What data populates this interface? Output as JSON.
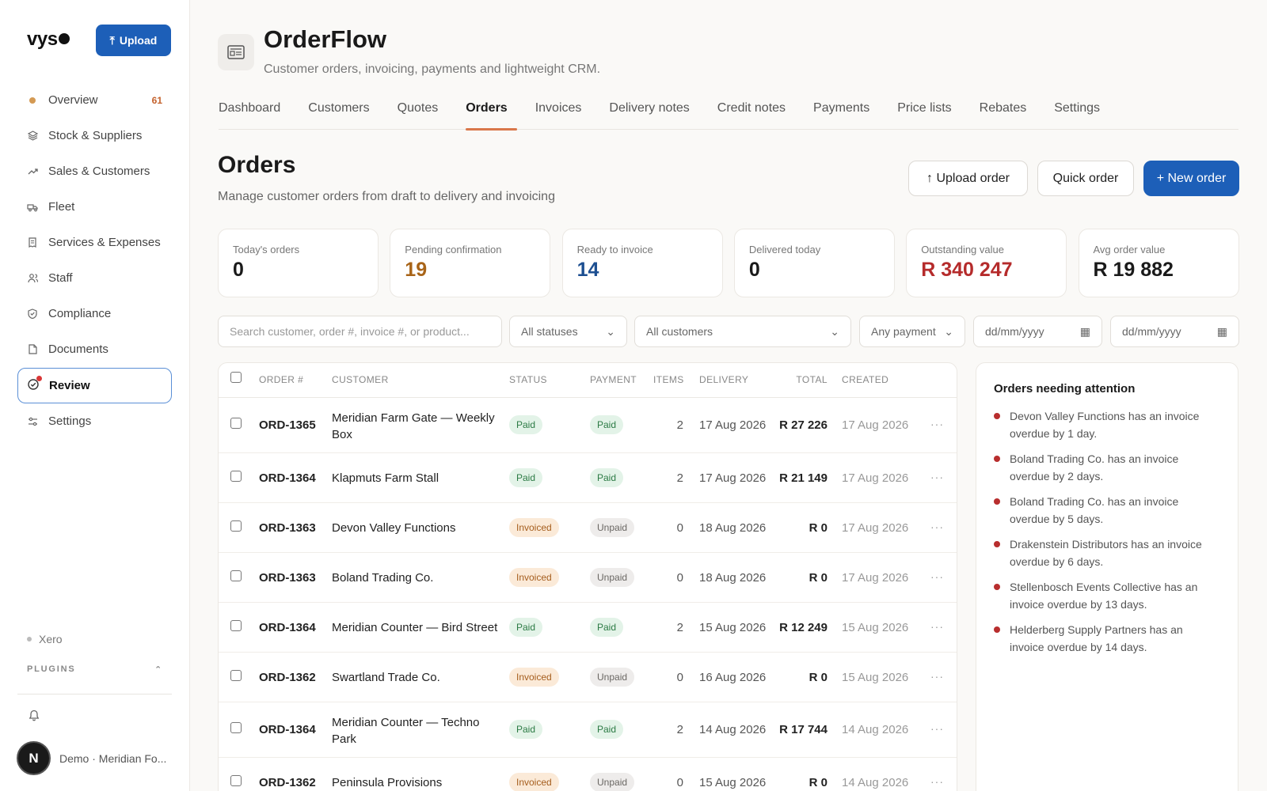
{
  "sidebar": {
    "logo": "vys",
    "upload_label": "Upload",
    "items": [
      {
        "label": "Overview",
        "badge": "61",
        "icon": "status-dot-icon"
      },
      {
        "label": "Stock & Suppliers",
        "icon": "layers-icon"
      },
      {
        "label": "Sales & Customers",
        "icon": "trend-up-icon"
      },
      {
        "label": "Fleet",
        "icon": "truck-icon"
      },
      {
        "label": "Services & Expenses",
        "icon": "receipt-icon"
      },
      {
        "label": "Staff",
        "icon": "users-icon"
      },
      {
        "label": "Compliance",
        "icon": "shield-check-icon"
      },
      {
        "label": "Documents",
        "icon": "document-icon"
      },
      {
        "label": "Review",
        "icon": "check-circle-icon",
        "active": true
      },
      {
        "label": "Settings",
        "icon": "sliders-icon"
      }
    ],
    "integration": "Xero",
    "plugins_label": "PLUGINS",
    "user_initial": "N",
    "user_name": "Demo · Meridian Fo..."
  },
  "header": {
    "title": "OrderFlow",
    "subtitle": "Customer orders, invoicing, payments and lightweight CRM.",
    "tabs": [
      "Dashboard",
      "Customers",
      "Quotes",
      "Orders",
      "Invoices",
      "Delivery notes",
      "Credit notes",
      "Payments",
      "Price lists",
      "Rebates",
      "Settings"
    ],
    "active_tab": "Orders"
  },
  "page": {
    "title": "Orders",
    "subtitle": "Manage customer orders from draft to delivery and invoicing",
    "upload_order": "↑ Upload order",
    "quick_order": "Quick order",
    "new_order": "+ New order"
  },
  "stats": [
    {
      "label": "Today's orders",
      "value": "0",
      "color": "#1a1a1a"
    },
    {
      "label": "Pending confirmation",
      "value": "19",
      "color": "#a86418"
    },
    {
      "label": "Ready to invoice",
      "value": "14",
      "color": "#1d4f91"
    },
    {
      "label": "Delivered today",
      "value": "0",
      "color": "#1a1a1a"
    },
    {
      "label": "Outstanding value",
      "value": "R 340 247",
      "color": "#b52b2b"
    },
    {
      "label": "Avg order value",
      "value": "R 19 882",
      "color": "#1a1a1a"
    }
  ],
  "filters": {
    "search_placeholder": "Search customer, order #, invoice #, or product...",
    "status": "All statuses",
    "customer": "All customers",
    "payment": "Any payment",
    "date_from": "dd/mm/yyyy",
    "date_to": "dd/mm/yyyy"
  },
  "table": {
    "headers": [
      "ORDER #",
      "CUSTOMER",
      "STATUS",
      "PAYMENT",
      "ITEMS",
      "DELIVERY",
      "TOTAL",
      "CREATED"
    ],
    "rows": [
      {
        "order": "ORD-1365",
        "customer": "Meridian Farm Gate — Weekly",
        "customer2": "Box",
        "status": "Paid",
        "payment": "Paid",
        "items": "2",
        "delivery": "17 Aug 2026",
        "total": "R 27 226",
        "created": "17 Aug 2026"
      },
      {
        "order": "ORD-1364",
        "customer": "Klapmuts Farm Stall",
        "customer2": "",
        "status": "Paid",
        "payment": "Paid",
        "items": "2",
        "delivery": "17 Aug 2026",
        "total": "R 21 149",
        "created": "17 Aug 2026"
      },
      {
        "order": "ORD-1363",
        "customer": "Devon Valley Functions",
        "customer2": "",
        "status": "Invoiced",
        "payment": "Unpaid",
        "items": "0",
        "delivery": "18 Aug 2026",
        "total": "R 0",
        "created": "17 Aug 2026"
      },
      {
        "order": "ORD-1363",
        "customer": "Boland Trading Co.",
        "customer2": "",
        "status": "Invoiced",
        "payment": "Unpaid",
        "items": "0",
        "delivery": "18 Aug 2026",
        "total": "R 0",
        "created": "17 Aug 2026"
      },
      {
        "order": "ORD-1364",
        "customer": "Meridian Counter — Bird Street",
        "customer2": "",
        "status": "Paid",
        "payment": "Paid",
        "items": "2",
        "delivery": "15 Aug 2026",
        "total": "R 12 249",
        "created": "15 Aug 2026"
      },
      {
        "order": "ORD-1362",
        "customer": "Swartland Trade Co.",
        "customer2": "",
        "status": "Invoiced",
        "payment": "Unpaid",
        "items": "0",
        "delivery": "16 Aug 2026",
        "total": "R 0",
        "created": "15 Aug 2026"
      },
      {
        "order": "ORD-1364",
        "customer": "Meridian Counter — Techno",
        "customer2": "Park",
        "status": "Paid",
        "payment": "Paid",
        "items": "2",
        "delivery": "14 Aug 2026",
        "total": "R 17 744",
        "created": "14 Aug 2026"
      },
      {
        "order": "ORD-1362",
        "customer": "Peninsula Provisions",
        "customer2": "",
        "status": "Invoiced",
        "payment": "Unpaid",
        "items": "0",
        "delivery": "15 Aug 2026",
        "total": "R 0",
        "created": "14 Aug 2026"
      }
    ]
  },
  "attention": {
    "title": "Orders needing attention",
    "items": [
      "Devon Valley Functions has an invoice overdue by 1 day.",
      "Boland Trading Co. has an invoice overdue by 2 days.",
      "Boland Trading Co. has an invoice overdue by 5 days.",
      "Drakenstein Distributors has an invoice overdue by 6 days.",
      "Stellenbosch Events Collective has an invoice overdue by 13 days.",
      "Helderberg Supply Partners has an invoice overdue by 14 days."
    ]
  }
}
